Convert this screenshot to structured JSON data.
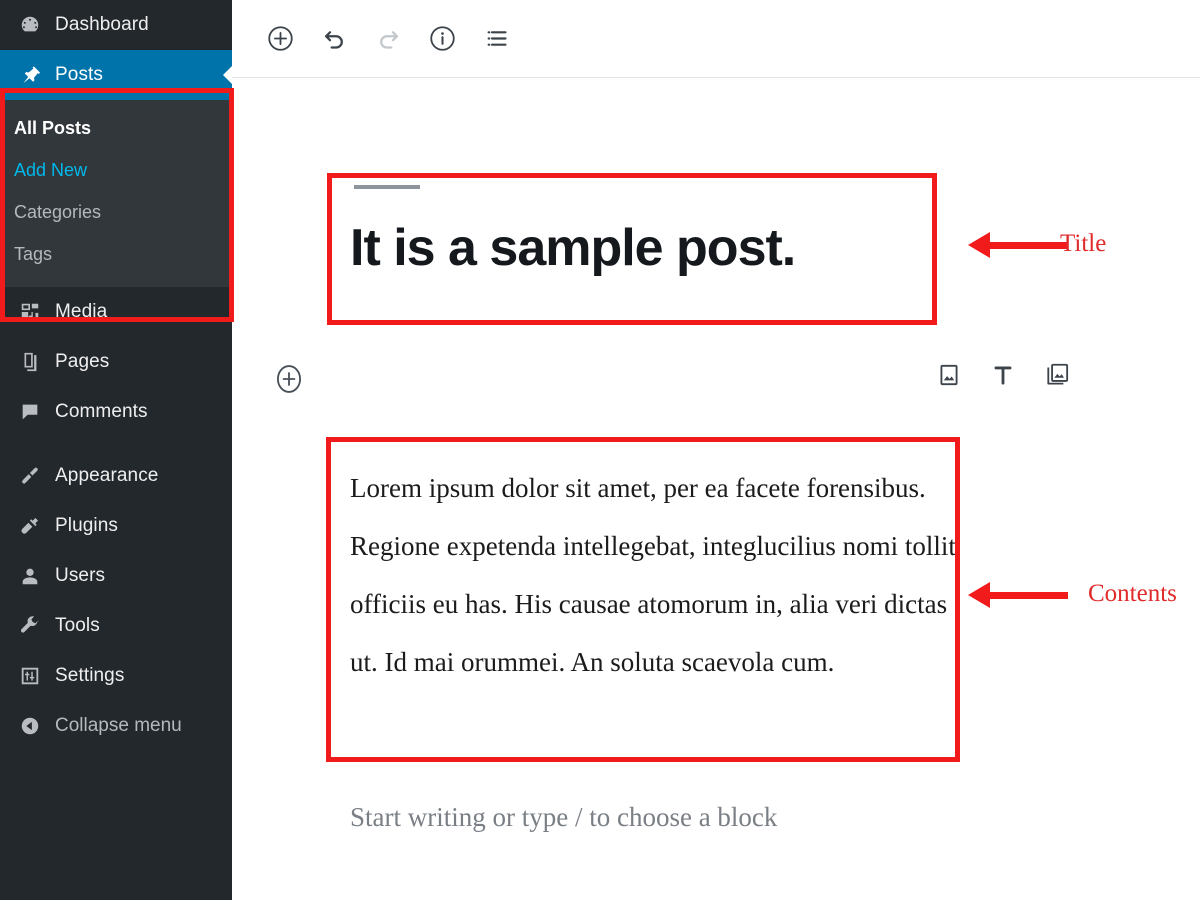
{
  "sidebar": {
    "items": [
      {
        "label": "Dashboard",
        "icon": "dashboard-icon",
        "state": "normal"
      },
      {
        "label": "Posts",
        "icon": "pin-icon",
        "state": "active"
      },
      {
        "label": "Media",
        "icon": "media-icon",
        "state": "normal"
      },
      {
        "label": "Pages",
        "icon": "pages-icon",
        "state": "normal"
      },
      {
        "label": "Comments",
        "icon": "comments-icon",
        "state": "normal"
      },
      {
        "label": "Appearance",
        "icon": "brush-icon",
        "state": "normal"
      },
      {
        "label": "Plugins",
        "icon": "plug-icon",
        "state": "normal"
      },
      {
        "label": "Users",
        "icon": "user-icon",
        "state": "normal"
      },
      {
        "label": "Tools",
        "icon": "wrench-icon",
        "state": "normal"
      },
      {
        "label": "Settings",
        "icon": "settings-icon",
        "state": "normal"
      }
    ],
    "submenu": [
      {
        "label": "All Posts",
        "state": "current"
      },
      {
        "label": "Add New",
        "state": "hovered"
      },
      {
        "label": "Categories",
        "state": "normal"
      },
      {
        "label": "Tags",
        "state": "normal"
      }
    ],
    "collapse": {
      "label": "Collapse menu",
      "icon": "collapse-arrow-icon"
    }
  },
  "toolbar": {
    "buttons": [
      {
        "name": "add-block-button",
        "icon": "circle-plus-icon",
        "enabled": true
      },
      {
        "name": "undo-button",
        "icon": "undo-icon",
        "enabled": true
      },
      {
        "name": "redo-button",
        "icon": "redo-icon",
        "enabled": false
      },
      {
        "name": "details-button",
        "icon": "info-circle-icon",
        "enabled": true
      },
      {
        "name": "list-view-button",
        "icon": "list-view-icon",
        "enabled": true
      }
    ]
  },
  "editor": {
    "title": "It is a sample post.",
    "body": "Lorem ipsum dolor sit amet, per ea facete forensibus. Regione expetenda intellegebat, integlucilius nomi tollit officiis eu has. His causae atomorum in, alia veri dictas ut. Id mai orummei. An soluta scaevola cum.",
    "placeholder": "Start writing or type / to choose a block",
    "block_shortcuts": [
      {
        "name": "image-block-icon",
        "label": "Image"
      },
      {
        "name": "paragraph-block-icon",
        "label": "T"
      },
      {
        "name": "gallery-block-icon",
        "label": "Gallery"
      }
    ],
    "inserter": {
      "name": "block-inserter-button",
      "icon": "circle-plus-icon"
    }
  },
  "annotations": {
    "title_label": "Title",
    "contents_label": "Contents",
    "color": "#f21b1b"
  },
  "colors": {
    "sidebar_bg": "#23282d",
    "submenu_bg": "#32373c",
    "accent_blue": "#0073aa",
    "link_blue": "#00b9eb",
    "annotation_red": "#f21b1b"
  }
}
